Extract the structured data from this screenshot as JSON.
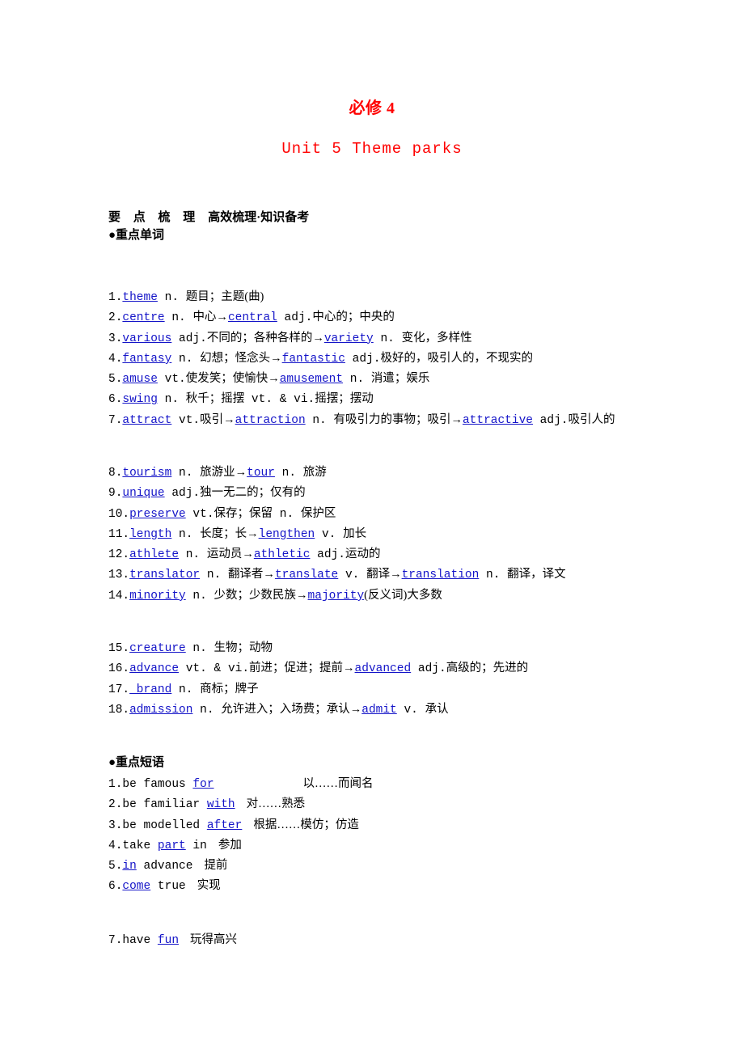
{
  "document": {
    "book_title": "必修 4",
    "unit_title": "Unit 5  Theme parks"
  },
  "headings": {
    "outline_main": "要 点 梳 理",
    "outline_sub": "高效梳理·知识备考",
    "words": "●重点单词",
    "phrases": "●重点短语"
  },
  "colors": {
    "title_red": "#ff0000",
    "keyword_blue": "#1414c8",
    "body_black": "#000000"
  },
  "words": [
    {
      "num": "1.",
      "parts": [
        {
          "t": "kw",
          "v": "theme"
        },
        {
          "t": "en",
          "v": " n. "
        },
        {
          "t": "cn",
          "v": "题目；主题(曲)"
        }
      ]
    },
    {
      "num": "2.",
      "parts": [
        {
          "t": "kw",
          "v": "centre"
        },
        {
          "t": "en",
          "v": " n. "
        },
        {
          "t": "cn",
          "v": "中心→"
        },
        {
          "t": "kw",
          "v": "central"
        },
        {
          "t": "en",
          "v": " adj."
        },
        {
          "t": "cn",
          "v": "中心的；中央的"
        }
      ]
    },
    {
      "num": "3.",
      "parts": [
        {
          "t": "kw",
          "v": "various"
        },
        {
          "t": "en",
          "v": " adj."
        },
        {
          "t": "cn",
          "v": "不同的；各种各样的→"
        },
        {
          "t": "kw",
          "v": "variety"
        },
        {
          "t": "en",
          "v": " n. "
        },
        {
          "t": "cn",
          "v": "变化，多样性"
        }
      ]
    },
    {
      "num": "4.",
      "parts": [
        {
          "t": "kw",
          "v": "fantasy"
        },
        {
          "t": "en",
          "v": " n. "
        },
        {
          "t": "cn",
          "v": "幻想；怪念头→"
        },
        {
          "t": "kw",
          "v": "fantastic"
        },
        {
          "t": "en",
          "v": " adj."
        },
        {
          "t": "cn",
          "v": "极好的，吸引人的，不现实的"
        }
      ]
    },
    {
      "num": "5.",
      "parts": [
        {
          "t": "kw",
          "v": "amuse"
        },
        {
          "t": "en",
          "v": " vt."
        },
        {
          "t": "cn",
          "v": "使发笑；使愉快→"
        },
        {
          "t": "kw",
          "v": "amusement"
        },
        {
          "t": "en",
          "v": " n. "
        },
        {
          "t": "cn",
          "v": "消遣；娱乐"
        }
      ]
    },
    {
      "num": "6.",
      "parts": [
        {
          "t": "kw",
          "v": "swing"
        },
        {
          "t": "en",
          "v": " n. "
        },
        {
          "t": "cn",
          "v": "秋千；摇摆"
        },
        {
          "t": "en",
          "v": " vt. & vi."
        },
        {
          "t": "cn",
          "v": "摇摆；摆动"
        }
      ]
    },
    {
      "num": "7.",
      "parts": [
        {
          "t": "kw",
          "v": "attract"
        },
        {
          "t": "en",
          "v": " vt."
        },
        {
          "t": "cn",
          "v": "吸引→"
        },
        {
          "t": "kw",
          "v": "attraction"
        },
        {
          "t": "en",
          "v": " n. "
        },
        {
          "t": "cn",
          "v": "有吸引力的事物；吸引→"
        },
        {
          "t": "kw",
          "v": "attractive"
        },
        {
          "t": "en",
          "v": " adj."
        },
        {
          "t": "cn",
          "v": "吸引人的"
        }
      ]
    },
    {
      "num": "8.",
      "parts": [
        {
          "t": "kw",
          "v": "tourism"
        },
        {
          "t": "en",
          "v": " n. "
        },
        {
          "t": "cn",
          "v": "旅游业→"
        },
        {
          "t": "kw",
          "v": "tour"
        },
        {
          "t": "en",
          "v": " n. "
        },
        {
          "t": "cn",
          "v": "旅游"
        }
      ]
    },
    {
      "num": "9.",
      "parts": [
        {
          "t": "kw",
          "v": "unique"
        },
        {
          "t": "en",
          "v": " adj."
        },
        {
          "t": "cn",
          "v": "独一无二的；仅有的"
        }
      ]
    },
    {
      "num": "10.",
      "parts": [
        {
          "t": "kw",
          "v": "preserve"
        },
        {
          "t": "en",
          "v": " vt."
        },
        {
          "t": "cn",
          "v": "保存；保留"
        },
        {
          "t": "en",
          "v": " n. "
        },
        {
          "t": "cn",
          "v": "保护区"
        }
      ]
    },
    {
      "num": "11.",
      "parts": [
        {
          "t": "kw",
          "v": "length"
        },
        {
          "t": "en",
          "v": " n. "
        },
        {
          "t": "cn",
          "v": "长度；长→"
        },
        {
          "t": "kw",
          "v": "lengthen"
        },
        {
          "t": "en",
          "v": " v. "
        },
        {
          "t": "cn",
          "v": "加长"
        }
      ]
    },
    {
      "num": "12.",
      "parts": [
        {
          "t": "kw",
          "v": "athlete"
        },
        {
          "t": "en",
          "v": " n. "
        },
        {
          "t": "cn",
          "v": "运动员→"
        },
        {
          "t": "kw",
          "v": "athletic"
        },
        {
          "t": "en",
          "v": " adj."
        },
        {
          "t": "cn",
          "v": "运动的"
        }
      ]
    },
    {
      "num": "13.",
      "parts": [
        {
          "t": "kw",
          "v": "translator"
        },
        {
          "t": "en",
          "v": " n. "
        },
        {
          "t": "cn",
          "v": "翻译者→"
        },
        {
          "t": "kw",
          "v": "translate"
        },
        {
          "t": "en",
          "v": " v. "
        },
        {
          "t": "cn",
          "v": "翻译→"
        },
        {
          "t": "kw",
          "v": "translation"
        },
        {
          "t": "en",
          "v": " n. "
        },
        {
          "t": "cn",
          "v": "翻译，译文"
        }
      ]
    },
    {
      "num": "14.",
      "parts": [
        {
          "t": "kw",
          "v": "minority"
        },
        {
          "t": "en",
          "v": " n. "
        },
        {
          "t": "cn",
          "v": "少数；少数民族→"
        },
        {
          "t": "kw",
          "v": "majority"
        },
        {
          "t": "cn",
          "v": "(反义词)大多数"
        }
      ]
    },
    {
      "num": "15.",
      "parts": [
        {
          "t": "kw",
          "v": "creature"
        },
        {
          "t": "en",
          "v": " n. "
        },
        {
          "t": "cn",
          "v": "生物；动物"
        }
      ]
    },
    {
      "num": "16.",
      "parts": [
        {
          "t": "kw",
          "v": "advance"
        },
        {
          "t": "en",
          "v": " vt. & vi."
        },
        {
          "t": "cn",
          "v": "前进；促进；提前→"
        },
        {
          "t": "kw",
          "v": "advanced"
        },
        {
          "t": "en",
          "v": " adj."
        },
        {
          "t": "cn",
          "v": "高级的；先进的"
        }
      ]
    },
    {
      "num": "17.",
      "parts": [
        {
          "t": "kw",
          "v": " brand"
        },
        {
          "t": "en",
          "v": " n. "
        },
        {
          "t": "cn",
          "v": "商标；牌子"
        }
      ]
    },
    {
      "num": "18.",
      "parts": [
        {
          "t": "kw",
          "v": "admission"
        },
        {
          "t": "en",
          "v": " n. "
        },
        {
          "t": "cn",
          "v": "允许进入；入场费；承认→"
        },
        {
          "t": "kw",
          "v": "admit"
        },
        {
          "t": "en",
          "v": " v. "
        },
        {
          "t": "cn",
          "v": "承认"
        }
      ]
    }
  ],
  "phrases": [
    {
      "num": "1.",
      "parts": [
        {
          "t": "en",
          "v": "be famous "
        },
        {
          "t": "kw",
          "v": "for"
        },
        {
          "t": "gap-big",
          "v": ""
        },
        {
          "t": "cn",
          "v": "以……而闻名"
        }
      ]
    },
    {
      "num": "2.",
      "parts": [
        {
          "t": "en",
          "v": "be familiar "
        },
        {
          "t": "kw",
          "v": "with"
        },
        {
          "t": "gap-mid",
          "v": ""
        },
        {
          "t": "cn",
          "v": "对……熟悉"
        }
      ]
    },
    {
      "num": "3.",
      "parts": [
        {
          "t": "en",
          "v": "be modelled "
        },
        {
          "t": "kw",
          "v": "after"
        },
        {
          "t": "gap-mid",
          "v": ""
        },
        {
          "t": "cn",
          "v": "根据……模仿；仿造"
        }
      ]
    },
    {
      "num": "4.",
      "parts": [
        {
          "t": "en",
          "v": "take "
        },
        {
          "t": "kw",
          "v": "part"
        },
        {
          "t": "en",
          "v": " in"
        },
        {
          "t": "gap-mid",
          "v": ""
        },
        {
          "t": "cn",
          "v": "参加"
        }
      ]
    },
    {
      "num": "5.",
      "parts": [
        {
          "t": "kw",
          "v": "in"
        },
        {
          "t": "en",
          "v": " advance"
        },
        {
          "t": "gap-mid",
          "v": ""
        },
        {
          "t": "cn",
          "v": "提前"
        }
      ]
    },
    {
      "num": "6.",
      "parts": [
        {
          "t": "kw",
          "v": "come"
        },
        {
          "t": "en",
          "v": " true"
        },
        {
          "t": "gap-mid",
          "v": ""
        },
        {
          "t": "cn",
          "v": "实现"
        }
      ]
    },
    {
      "num": "7.",
      "parts": [
        {
          "t": "en",
          "v": "have "
        },
        {
          "t": "kw",
          "v": "fun"
        },
        {
          "t": "gap-mid",
          "v": ""
        },
        {
          "t": "cn",
          "v": "玩得高兴"
        }
      ]
    }
  ]
}
